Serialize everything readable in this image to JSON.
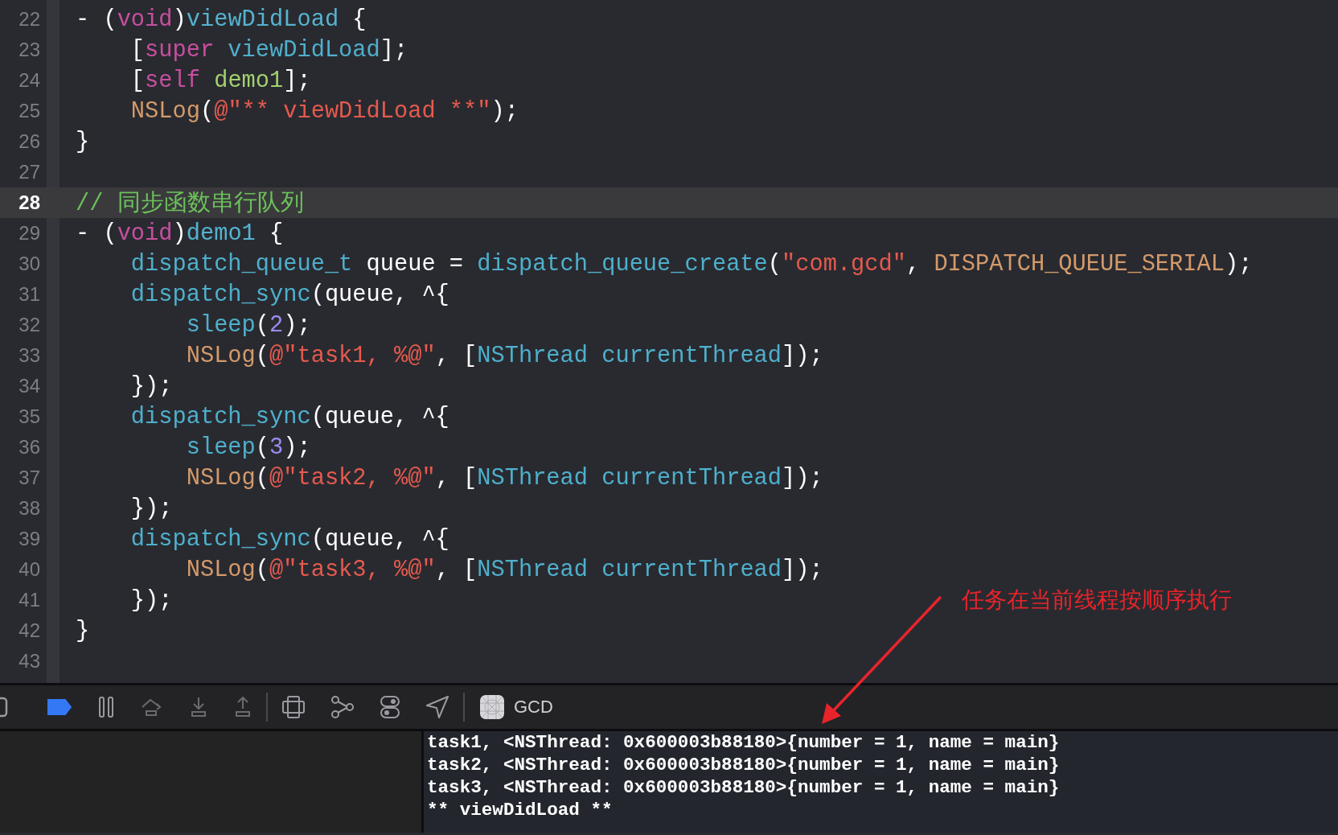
{
  "editor": {
    "lines": [
      {
        "number": "22",
        "selected": false,
        "tokens": [
          {
            "t": "- (",
            "kind": "plain"
          },
          {
            "t": "void",
            "kind": "keyword"
          },
          {
            "t": ")",
            "kind": "plain"
          },
          {
            "t": "viewDidLoad",
            "kind": "decl"
          },
          {
            "t": " {",
            "kind": "plain"
          }
        ]
      },
      {
        "number": "23",
        "selected": false,
        "tokens": [
          {
            "t": "    [",
            "kind": "plain"
          },
          {
            "t": "super",
            "kind": "keyword"
          },
          {
            "t": " viewDidLoad",
            "kind": "function"
          },
          {
            "t": "];",
            "kind": "plain"
          }
        ]
      },
      {
        "number": "24",
        "selected": false,
        "tokens": [
          {
            "t": "    [",
            "kind": "plain"
          },
          {
            "t": "self",
            "kind": "keyword"
          },
          {
            "t": " demo1",
            "kind": "project"
          },
          {
            "t": "];",
            "kind": "plain"
          }
        ]
      },
      {
        "number": "25",
        "selected": false,
        "tokens": [
          {
            "t": "    NSLog",
            "kind": "macro"
          },
          {
            "t": "(",
            "kind": "plain"
          },
          {
            "t": "@\"** viewDidLoad **\"",
            "kind": "string"
          },
          {
            "t": ");",
            "kind": "plain"
          }
        ]
      },
      {
        "number": "26",
        "selected": false,
        "tokens": [
          {
            "t": "}",
            "kind": "plain"
          }
        ]
      },
      {
        "number": "27",
        "selected": false
      },
      {
        "number": "28",
        "selected": true,
        "tokens": [
          {
            "t": "// 同步函数串行队列",
            "kind": "comment"
          }
        ]
      },
      {
        "number": "29",
        "selected": false,
        "tokens": [
          {
            "t": "- (",
            "kind": "plain"
          },
          {
            "t": "void",
            "kind": "keyword"
          },
          {
            "t": ")",
            "kind": "plain"
          },
          {
            "t": "demo1",
            "kind": "decl"
          },
          {
            "t": " {",
            "kind": "plain"
          }
        ]
      },
      {
        "number": "30",
        "selected": false,
        "tokens": [
          {
            "t": "    dispatch_queue_t",
            "kind": "function"
          },
          {
            "t": " queue = ",
            "kind": "plain"
          },
          {
            "t": "dispatch_queue_create",
            "kind": "function"
          },
          {
            "t": "(",
            "kind": "plain"
          },
          {
            "t": "\"com.gcd\"",
            "kind": "string"
          },
          {
            "t": ", ",
            "kind": "plain"
          },
          {
            "t": "DISPATCH_QUEUE_SERIAL",
            "kind": "macro"
          },
          {
            "t": ");",
            "kind": "plain"
          }
        ]
      },
      {
        "number": "31",
        "selected": false,
        "tokens": [
          {
            "t": "    dispatch_sync",
            "kind": "function"
          },
          {
            "t": "(queue, ^{",
            "kind": "plain"
          }
        ]
      },
      {
        "number": "32",
        "selected": false,
        "tokens": [
          {
            "t": "        sleep",
            "kind": "function"
          },
          {
            "t": "(",
            "kind": "plain"
          },
          {
            "t": "2",
            "kind": "number"
          },
          {
            "t": ");",
            "kind": "plain"
          }
        ]
      },
      {
        "number": "33",
        "selected": false,
        "tokens": [
          {
            "t": "        NSLog",
            "kind": "macro"
          },
          {
            "t": "(",
            "kind": "plain"
          },
          {
            "t": "@\"task1, %@\"",
            "kind": "string"
          },
          {
            "t": ", [",
            "kind": "plain"
          },
          {
            "t": "NSThread",
            "kind": "function"
          },
          {
            "t": " currentThread",
            "kind": "function"
          },
          {
            "t": "]);",
            "kind": "plain"
          }
        ]
      },
      {
        "number": "34",
        "selected": false,
        "tokens": [
          {
            "t": "    });",
            "kind": "plain"
          }
        ]
      },
      {
        "number": "35",
        "selected": false,
        "tokens": [
          {
            "t": "    dispatch_sync",
            "kind": "function"
          },
          {
            "t": "(queue, ^{",
            "kind": "plain"
          }
        ]
      },
      {
        "number": "36",
        "selected": false,
        "tokens": [
          {
            "t": "        sleep",
            "kind": "function"
          },
          {
            "t": "(",
            "kind": "plain"
          },
          {
            "t": "3",
            "kind": "number"
          },
          {
            "t": ");",
            "kind": "plain"
          }
        ]
      },
      {
        "number": "37",
        "selected": false,
        "tokens": [
          {
            "t": "        NSLog",
            "kind": "macro"
          },
          {
            "t": "(",
            "kind": "plain"
          },
          {
            "t": "@\"task2, %@\"",
            "kind": "string"
          },
          {
            "t": ", [",
            "kind": "plain"
          },
          {
            "t": "NSThread",
            "kind": "function"
          },
          {
            "t": " currentThread",
            "kind": "function"
          },
          {
            "t": "]);",
            "kind": "plain"
          }
        ]
      },
      {
        "number": "38",
        "selected": false,
        "tokens": [
          {
            "t": "    });",
            "kind": "plain"
          }
        ]
      },
      {
        "number": "39",
        "selected": false,
        "tokens": [
          {
            "t": "    dispatch_sync",
            "kind": "function"
          },
          {
            "t": "(queue, ^{",
            "kind": "plain"
          }
        ]
      },
      {
        "number": "40",
        "selected": false,
        "tokens": [
          {
            "t": "        NSLog",
            "kind": "macro"
          },
          {
            "t": "(",
            "kind": "plain"
          },
          {
            "t": "@\"task3, %@\"",
            "kind": "string"
          },
          {
            "t": ", [",
            "kind": "plain"
          },
          {
            "t": "NSThread",
            "kind": "function"
          },
          {
            "t": " currentThread",
            "kind": "function"
          },
          {
            "t": "]);",
            "kind": "plain"
          }
        ]
      },
      {
        "number": "41",
        "selected": false,
        "tokens": [
          {
            "t": "    });",
            "kind": "plain"
          }
        ]
      },
      {
        "number": "42",
        "selected": false,
        "tokens": [
          {
            "t": "}",
            "kind": "plain"
          }
        ]
      },
      {
        "number": "43",
        "selected": false
      }
    ]
  },
  "annotation": {
    "text": "任务在当前线程按顺序执行"
  },
  "debug_bar": {
    "breakpoints_active": true,
    "process": "GCD"
  },
  "console": {
    "lines": [
      "task1, <NSThread: 0x600003b88180>{number = 1, name = main}",
      "task2, <NSThread: 0x600003b88180>{number = 1, name = main}",
      "task3, <NSThread: 0x600003b88180>{number = 1, name = main}",
      "** viewDidLoad **"
    ]
  }
}
